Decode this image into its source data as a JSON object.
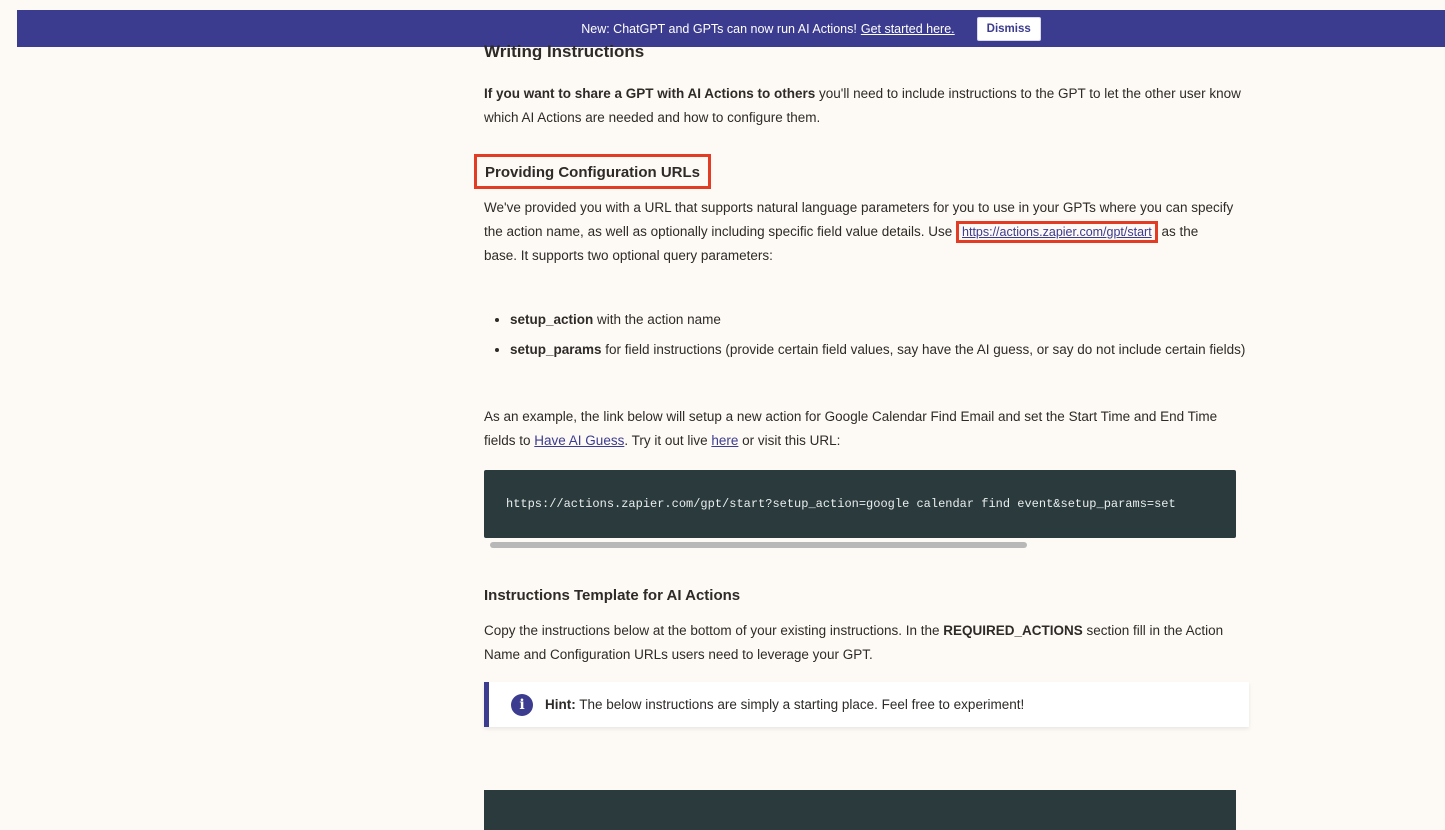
{
  "banner": {
    "text": "New: ChatGPT and GPTs can now run AI Actions!",
    "link": "Get started here.",
    "dismiss": "Dismiss"
  },
  "writing": {
    "heading": "Writing Instructions",
    "bold_lead": "If you want to share a GPT with AI Actions to others",
    "rest": " you'll need to include instructions to the GPT to let the other user know which AI Actions are needed and how to configure them."
  },
  "config": {
    "heading": "Providing Configuration URLs",
    "para_part1": "We've provided you with a URL that supports natural language parameters for you to use in your GPTs where you can specify the action name, as well as optionally including specific field value details. Use ",
    "url": "https://actions.zapier.com/gpt/start",
    "para_part2": " as the base. It supports two optional query parameters:",
    "params": [
      {
        "name": "setup_action",
        "desc": " with the action name"
      },
      {
        "name": "setup_params",
        "desc": " for field instructions (provide certain field values, say have the AI guess, or say do not include certain fields)"
      }
    ],
    "example_part1": "As an example, the link below will setup a new action for Google Calendar Find Email and set the Start Time and End Time fields to ",
    "example_link1": "Have AI Guess",
    "example_part2": ". Try it out live ",
    "example_link2": "here",
    "example_part3": " or visit this URL:",
    "code": "https://actions.zapier.com/gpt/start?setup_action=google calendar find event&setup_params=set"
  },
  "template": {
    "heading": "Instructions Template for AI Actions",
    "para_part1": "Copy the instructions below at the bottom of your existing instructions. In the ",
    "para_bold": "REQUIRED_ACTIONS",
    "para_part2": " section fill in the Action Name and Configuration URLs users need to leverage your GPT.",
    "hint_label": "Hint:",
    "hint_text": " The below instructions are simply a starting place. Feel free to experiment!"
  },
  "colors": {
    "banner": "#3b3b8f",
    "highlight": "#e23d24",
    "code_bg": "#2b3a3d",
    "page_bg": "#fdf9f5"
  }
}
